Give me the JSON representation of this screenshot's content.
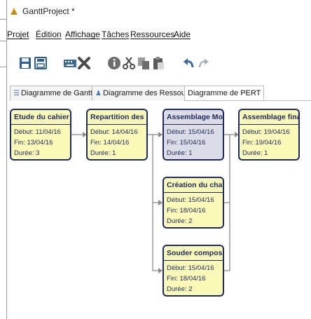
{
  "window": {
    "title": "GanttProject *"
  },
  "menu": [
    "Projet",
    "Édition",
    "Affichage",
    "Tâches",
    "Ressources",
    "Aide"
  ],
  "toolbar": [
    "save-icon",
    "save-as-icon",
    "keyboard-icon",
    "delete-icon",
    "info-icon",
    "cut-icon",
    "copy-icon",
    "paste-icon",
    "undo-icon",
    "redo-icon"
  ],
  "tabs": [
    {
      "label": "Diagramme de Gantt",
      "active": false
    },
    {
      "label": "Diagramme des Ressources",
      "active": false
    },
    {
      "label": "Diagramme de PERT",
      "active": true
    }
  ],
  "pert": {
    "start_label": "Début:",
    "end_label": "Fin:",
    "duration_label": "Durée:",
    "nodes": [
      {
        "title": "Etude du cahier d...",
        "start": "11/04/16",
        "end": "13/04/16",
        "duration": "3",
        "selected": false
      },
      {
        "title": "Repartition des r...",
        "start": "14/04/16",
        "end": "14/04/16",
        "duration": "1",
        "selected": false
      },
      {
        "title": "Assemblage Mot...",
        "start": "15/04/16",
        "end": "15/04/16",
        "duration": "1",
        "selected": true
      },
      {
        "title": "Assemblage final",
        "start": "19/04/16",
        "end": "19/04/16",
        "duration": "1",
        "selected": false
      },
      {
        "title": "Création du chas...",
        "start": "15/04/16",
        "end": "18/04/16",
        "duration": "2",
        "selected": false
      },
      {
        "title": "Souder composa...",
        "start": "15/04/16",
        "end": "18/04/16",
        "duration": "2",
        "selected": false
      }
    ]
  },
  "colors": {
    "node_fill": "#fafab8",
    "node_border": "#1f2a63",
    "selected_fill": "#dcdce6",
    "arrow": "#8a8a8a"
  }
}
